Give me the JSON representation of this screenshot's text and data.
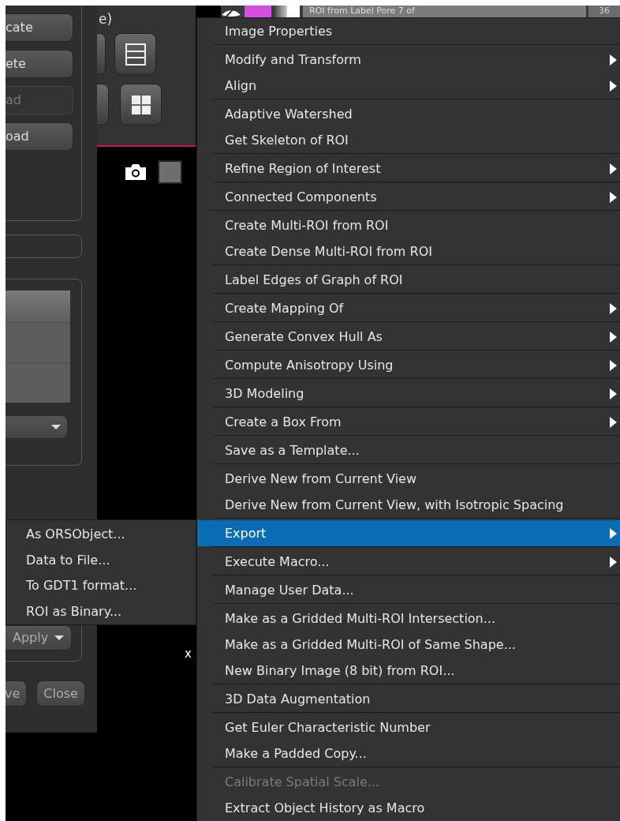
{
  "side_panel": {
    "buttons": [
      {
        "label": "cate",
        "disabled": false
      },
      {
        "label": "ete",
        "disabled": false
      },
      {
        "label": "ad",
        "disabled": true
      },
      {
        "label": "oad",
        "disabled": false
      }
    ],
    "apply_button": "Apply",
    "bottom_buttons": [
      "ve",
      "Close"
    ]
  },
  "view_panel": {
    "title": "e)"
  },
  "layer_row": {
    "name": "ROI from Label Pore 7 of",
    "count": "36"
  },
  "overlay_label": "x",
  "context_menu": {
    "groups": [
      [
        {
          "label": "Image Properties",
          "submenu": false,
          "selected": false,
          "disabled": false
        }
      ],
      [
        {
          "label": "Modify and Transform",
          "submenu": true,
          "selected": false,
          "disabled": false
        },
        {
          "label": "Align",
          "submenu": true,
          "selected": false,
          "disabled": false
        }
      ],
      [
        {
          "label": "Adaptive Watershed",
          "submenu": false,
          "selected": false,
          "disabled": false
        },
        {
          "label": "Get Skeleton of ROI",
          "submenu": false,
          "selected": false,
          "disabled": false
        }
      ],
      [
        {
          "label": "Refine Region of Interest",
          "submenu": true,
          "selected": false,
          "disabled": false
        }
      ],
      [
        {
          "label": "Connected Components",
          "submenu": true,
          "selected": false,
          "disabled": false
        }
      ],
      [
        {
          "label": "Create Multi-ROI from ROI",
          "submenu": false,
          "selected": false,
          "disabled": false
        },
        {
          "label": "Create Dense Multi-ROI from ROI",
          "submenu": false,
          "selected": false,
          "disabled": false
        }
      ],
      [
        {
          "label": "Label Edges of Graph of ROI",
          "submenu": false,
          "selected": false,
          "disabled": false
        }
      ],
      [
        {
          "label": "Create Mapping Of",
          "submenu": true,
          "selected": false,
          "disabled": false
        }
      ],
      [
        {
          "label": "Generate Convex Hull As",
          "submenu": true,
          "selected": false,
          "disabled": false
        }
      ],
      [
        {
          "label": "Compute Anisotropy Using",
          "submenu": true,
          "selected": false,
          "disabled": false
        }
      ],
      [
        {
          "label": "3D Modeling",
          "submenu": true,
          "selected": false,
          "disabled": false
        }
      ],
      [
        {
          "label": "Create a Box From",
          "submenu": true,
          "selected": false,
          "disabled": false
        }
      ],
      [
        {
          "label": "Save as a Template...",
          "submenu": false,
          "selected": false,
          "disabled": false
        }
      ],
      [
        {
          "label": "Derive New from Current View",
          "submenu": false,
          "selected": false,
          "disabled": false
        },
        {
          "label": "Derive New from Current View, with Isotropic Spacing",
          "submenu": false,
          "selected": false,
          "disabled": false
        }
      ],
      [
        {
          "label": "Export",
          "submenu": true,
          "selected": true,
          "disabled": false
        }
      ],
      [
        {
          "label": "Execute Macro...",
          "submenu": true,
          "selected": false,
          "disabled": false
        }
      ],
      [
        {
          "label": "Manage User Data...",
          "submenu": false,
          "selected": false,
          "disabled": false
        }
      ],
      [
        {
          "label": "Make as a Gridded Multi-ROI Intersection...",
          "submenu": false,
          "selected": false,
          "disabled": false
        },
        {
          "label": "Make as a Gridded Multi-ROI of Same Shape...",
          "submenu": false,
          "selected": false,
          "disabled": false
        },
        {
          "label": "New Binary Image (8 bit) from ROI...",
          "submenu": false,
          "selected": false,
          "disabled": false
        }
      ],
      [
        {
          "label": "3D Data Augmentation",
          "submenu": false,
          "selected": false,
          "disabled": false
        }
      ],
      [
        {
          "label": "Get Euler Characteristic Number",
          "submenu": false,
          "selected": false,
          "disabled": false
        },
        {
          "label": "Make a Padded Copy...",
          "submenu": false,
          "selected": false,
          "disabled": false
        }
      ],
      [
        {
          "label": "Calibrate Spatial Scale...",
          "submenu": false,
          "selected": false,
          "disabled": true
        },
        {
          "label": "Extract Object History as Macro",
          "submenu": false,
          "selected": false,
          "disabled": false
        }
      ]
    ]
  },
  "export_submenu": {
    "items": [
      "As ORSObject...",
      "Data to File...",
      "To GDT1 format...",
      "ROI as Binary..."
    ]
  }
}
